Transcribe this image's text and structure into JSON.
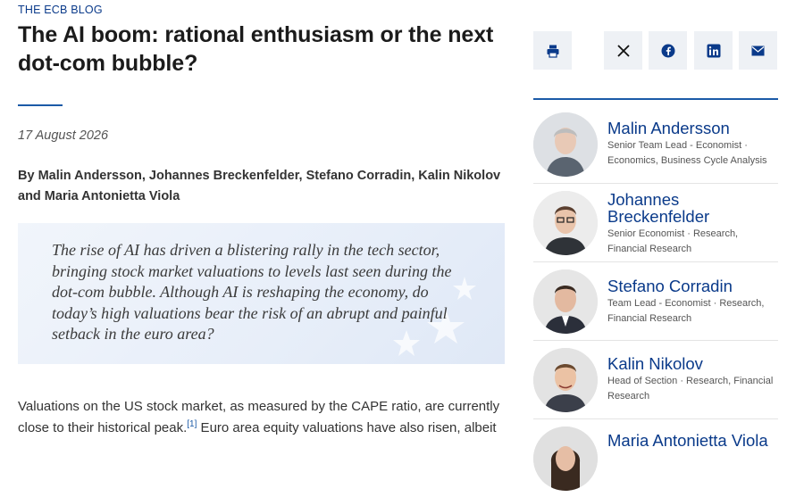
{
  "article": {
    "kicker": "THE ECB BLOG",
    "title": "The AI boom: rational enthusiasm or the next dot-com bubble?",
    "date": "17 August 2026",
    "authors_line": "By Malin Andersson, Johannes Breckenfelder, Stefano Corradin, Kalin Nikolov and Maria Antonietta Viola",
    "quote": "The rise of AI has driven a blistering rally in the tech sector, bringing stock market valuations to levels last seen during the dot-com bubble. Although AI is reshaping the economy, do today’s high valuations bear the risk of an abrupt and painful setback in the euro area?",
    "body_part1": "Valuations on the US stock market, as measured by the CAPE ratio, are currently close to their historical peak.",
    "footnote_marker": "[1]",
    "body_part2": " Euro area equity valuations have also risen, albeit"
  },
  "share": {
    "print": "print-icon",
    "x": "x-icon",
    "facebook": "facebook-icon",
    "linkedin": "linkedin-icon",
    "email": "email-icon",
    "accent": "#0a3a8a"
  },
  "authors": [
    {
      "name": "Malin Andersson",
      "role": "Senior Team Lead - Economist · Economics, Business Cycle Analysis"
    },
    {
      "name": "Johannes Breckenfelder",
      "role": "Senior Economist · Research, Financial Research"
    },
    {
      "name": "Stefano Corradin",
      "role": "Team Lead - Economist · Research, Financial Research"
    },
    {
      "name": "Kalin Nikolov",
      "role": "Head of Section · Research, Financial Research"
    },
    {
      "name": "Maria Antonietta Viola",
      "role": ""
    }
  ]
}
